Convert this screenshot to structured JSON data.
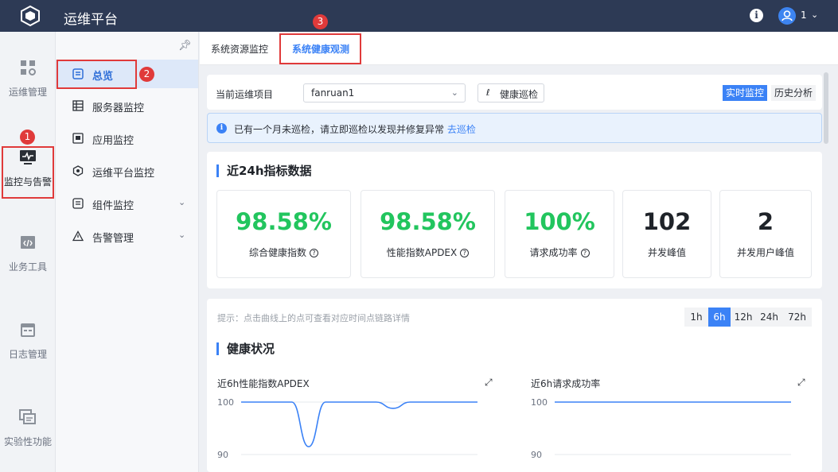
{
  "app": {
    "title": "运维平台",
    "user_name": "1"
  },
  "rail": {
    "items": [
      {
        "label": "运维管理"
      },
      {
        "label": "监控与告警"
      },
      {
        "label": "业务工具"
      },
      {
        "label": "日志管理"
      },
      {
        "label": "实验性功能"
      }
    ]
  },
  "nav": {
    "items": [
      {
        "label": "总览"
      },
      {
        "label": "服务器监控"
      },
      {
        "label": "应用监控"
      },
      {
        "label": "运维平台监控"
      },
      {
        "label": "组件监控"
      },
      {
        "label": "告警管理"
      }
    ]
  },
  "badges": [
    "1",
    "2",
    "3"
  ],
  "tabs": [
    {
      "label": "系统资源监控"
    },
    {
      "label": "系统健康观测"
    }
  ],
  "toolbar": {
    "project_label": "当前运维项目",
    "project_value": "fanruan1",
    "inspect_button": "健康巡检",
    "mode_realtime": "实时监控",
    "mode_history": "历史分析"
  },
  "alert": {
    "text": "已有一个月未巡检，请立即巡检以发现并修复异常",
    "link": "去巡检"
  },
  "metrics_section": {
    "title": "近24h指标数据"
  },
  "metrics": [
    {
      "value": "98.58%",
      "label": "综合健康指数"
    },
    {
      "value": "98.58%",
      "label": "性能指数APDEX"
    },
    {
      "value": "100%",
      "label": "请求成功率"
    },
    {
      "value": "102",
      "label": "并发峰值"
    },
    {
      "value": "2",
      "label": "并发用户峰值"
    }
  ],
  "health": {
    "hint": "提示：点击曲线上的点可查看对应时间点链路详情",
    "title": "健康状况",
    "ranges": [
      "1h",
      "6h",
      "12h",
      "24h",
      "72h"
    ],
    "selected_range": "6h"
  },
  "chart_data": [
    {
      "type": "line",
      "title": "近6h性能指数APDEX",
      "ylim": [
        90,
        100
      ],
      "yticks": [
        "100",
        "90"
      ],
      "series": [
        {
          "values": [
            100,
            100,
            100,
            100,
            91.5,
            100,
            100,
            100,
            100,
            98.8,
            100,
            100,
            100,
            100,
            100
          ]
        }
      ]
    },
    {
      "type": "line",
      "title": "近6h请求成功率",
      "ylim": [
        90,
        100
      ],
      "yticks": [
        "100",
        "90"
      ],
      "series": [
        {
          "values": [
            100,
            100,
            100,
            100,
            100,
            100,
            100,
            100,
            100,
            100,
            100,
            100,
            100,
            100,
            100
          ]
        }
      ]
    }
  ],
  "colors": {
    "accent": "#3b82f6",
    "topbar": "#2d3a55",
    "good": "#22c55e",
    "highlight": "#e03a3a"
  }
}
